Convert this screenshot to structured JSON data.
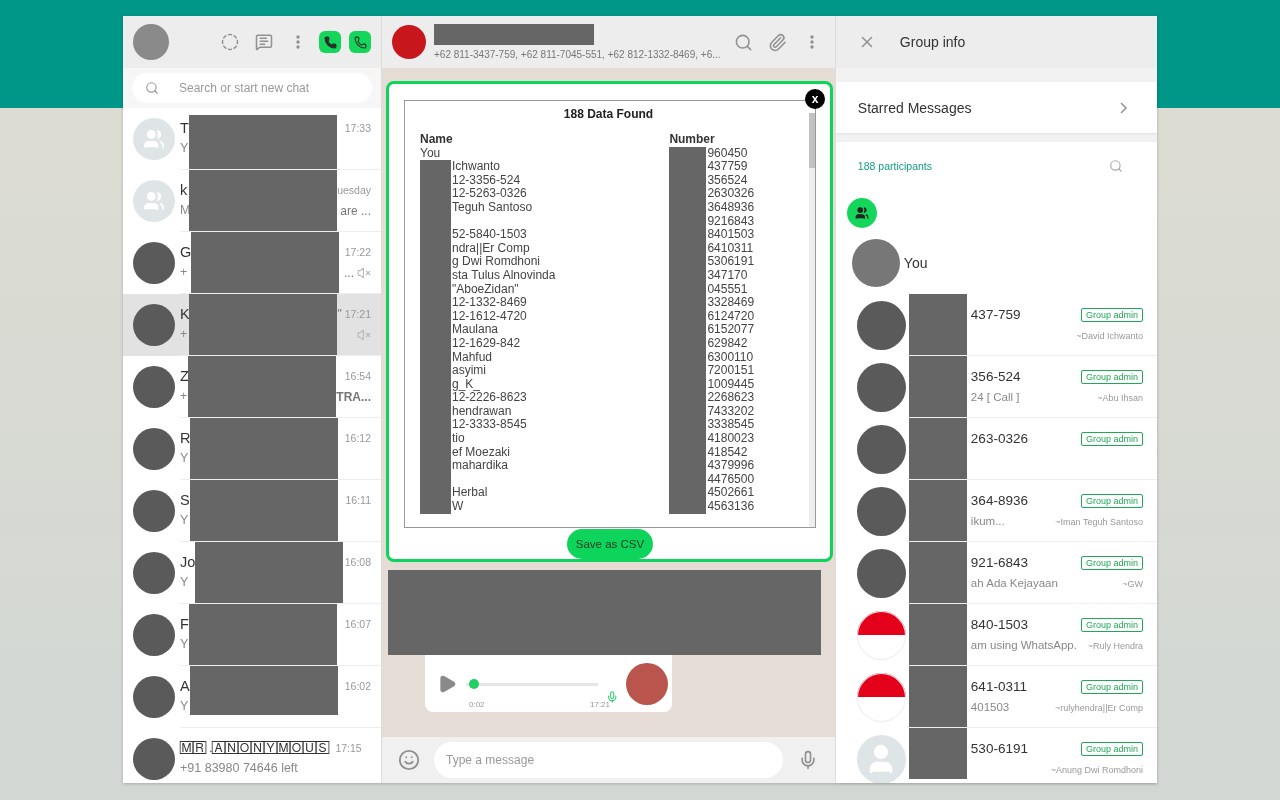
{
  "sidebar": {
    "search": {
      "placeholder": "Search or start new chat"
    },
    "chats": [
      {
        "kind": "group",
        "redacted": true,
        "name": "T",
        "preview": "Y",
        "time": "17:33",
        "muted": false,
        "selected": false
      },
      {
        "kind": "group",
        "redacted": true,
        "name": "k",
        "preview": "M",
        "time": "uesday",
        "preview_tail": "are ...",
        "muted": false,
        "selected": false
      },
      {
        "kind": "photo",
        "redacted": true,
        "name": "G",
        "preview": "+",
        "time": "17:22",
        "preview_tail": "...",
        "muted": true,
        "selected": false
      },
      {
        "kind": "photo",
        "redacted": true,
        "name": "K",
        "name_tail": "\"",
        "preview": "+",
        "time": "17:21",
        "muted": true,
        "selected": true
      },
      {
        "kind": "photo",
        "redacted": true,
        "name": "Z",
        "preview": "+",
        "time": "16:54",
        "preview_tail": "TRA...",
        "tail_bold": true,
        "muted": false,
        "selected": false
      },
      {
        "kind": "photo",
        "redacted": true,
        "name": "R",
        "preview": "Y",
        "time": "16:12",
        "muted": false,
        "selected": false
      },
      {
        "kind": "photo",
        "redacted": true,
        "name": "S",
        "preview": "Y",
        "time": "16:11",
        "muted": false,
        "selected": false
      },
      {
        "kind": "photo",
        "redacted": true,
        "name": "Jo",
        "preview": "Y",
        "time": "16:08",
        "muted": false,
        "selected": false
      },
      {
        "kind": "photo",
        "redacted": true,
        "name": "F",
        "preview": "Y",
        "time": "16:07",
        "muted": false,
        "selected": false
      },
      {
        "kind": "photo",
        "redacted": true,
        "name": "A",
        "preview": "Y",
        "time": "16:02",
        "muted": false,
        "selected": false
      },
      {
        "kind": "photo",
        "redacted": false,
        "name": "🄼🅁 .🄰🄽🄾🄽🅈🄼🄾🅄🅂",
        "preview": "+91 83980 74646 left",
        "time": "17:15",
        "muted": false,
        "selected": false
      }
    ]
  },
  "chat": {
    "subtitle": "+62 811-3437-759, +62 811-7045-551, +62 812-1332-8469, +6...",
    "voice_message": {
      "level": 0.02,
      "duration": "0:02",
      "time": "17:21"
    },
    "composer": {
      "placeholder": "Type a message"
    }
  },
  "popup": {
    "title": "188 Data Found",
    "close": "x",
    "columns": [
      "Name",
      "Number"
    ],
    "button": "Save as CSV",
    "rows": [
      {
        "name": "You",
        "number": "960450"
      },
      {
        "name": "Ichwanto",
        "number": "437759"
      },
      {
        "name": "12-3356-524",
        "number": "356524"
      },
      {
        "name": "12-5263-0326",
        "number": "2630326"
      },
      {
        "name": "Teguh Santoso",
        "number": "3648936"
      },
      {
        "number": "9216843"
      },
      {
        "name": "52-5840-1503",
        "number": "8401503"
      },
      {
        "name": "ndra||Er Comp",
        "number": "6410311"
      },
      {
        "name": "g Dwi Romdhoni",
        "number": "5306191"
      },
      {
        "name": "sta Tulus Alnovinda",
        "number": "347170"
      },
      {
        "name": "\"AboeZidan\"",
        "number": "045551"
      },
      {
        "name": "12-1332-8469",
        "number": "3328469"
      },
      {
        "name": "12-1612-4720",
        "number": "6124720"
      },
      {
        "name": "Maulana",
        "number": "6152077"
      },
      {
        "name": "12-1629-842",
        "number": "629842"
      },
      {
        "name": "Mahfud",
        "number": "6300110"
      },
      {
        "name": "asyimi",
        "number": "7200151"
      },
      {
        "name": "g_K_",
        "number": "1009445"
      },
      {
        "name": "12-2226-8623",
        "number": "2268623"
      },
      {
        "name": "hendrawan",
        "number": "7433202"
      },
      {
        "name": "12-3333-8545",
        "number": "3338545"
      },
      {
        "name": "tio",
        "number": "4180023"
      },
      {
        "name": "ef Moezaki",
        "number": "418542"
      },
      {
        "name": "mahardika",
        "number": "4379996"
      },
      {
        "number": "4476500"
      },
      {
        "name": "Herbal",
        "number": "4502661"
      },
      {
        "name": "W",
        "number": "4563136"
      }
    ]
  },
  "group_info": {
    "title": "Group info",
    "starred": "Starred Messages",
    "participants": "188 participants",
    "you": "You",
    "members": [
      {
        "kind": "photo",
        "phone": "437-759",
        "badge": "Group admin",
        "pushname": "~David Ichwanto"
      },
      {
        "kind": "photo",
        "phone": "356-524",
        "status": "24 [ Call ]",
        "badge": "Group admin",
        "pushname": "~Abu Ihsan"
      },
      {
        "kind": "photo",
        "phone": "263-0326",
        "badge": "Group admin"
      },
      {
        "kind": "photo",
        "phone": "364-8936",
        "status": "ikum...",
        "badge": "Group admin",
        "pushname": "~Iman Teguh Santoso"
      },
      {
        "kind": "photo",
        "phone": "921-6843",
        "status": "ah Ada Kejayaan",
        "badge": "Group admin",
        "pushname": "~GW"
      },
      {
        "kind": "flag",
        "phone": "840-1503",
        "status": "am using WhatsApp.",
        "badge": "Group admin",
        "pushname": "~Ruly Hendra"
      },
      {
        "kind": "flag",
        "phone": "641-0311",
        "status": "401503",
        "badge": "Group admin",
        "pushname": "~rulyhendra||Er Comp"
      },
      {
        "kind": "default",
        "phone": "530-6191",
        "badge": "Group admin",
        "pushname": "~Anung Dwi Romdhoni"
      }
    ]
  }
}
